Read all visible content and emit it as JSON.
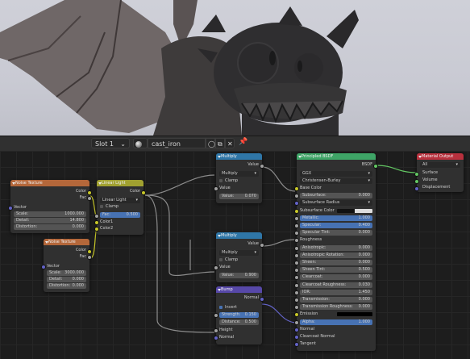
{
  "header": {
    "slot_label": "Slot 1",
    "material_name": "cast_iron"
  },
  "nodes": {
    "noise1": {
      "title": "Noise Texture",
      "color": "Color",
      "fac": "Fac",
      "vector": "Vector",
      "scale_label": "Scale:",
      "scale_value": "1000.000",
      "detail_label": "Detail:",
      "detail_value": "14.800",
      "distortion_label": "Distortion:",
      "distortion_value": "0.000"
    },
    "noise2": {
      "title": "Noise Texture",
      "color": "Color",
      "fac": "Fac",
      "vector": "Vector",
      "scale_label": "Scale:",
      "scale_value": "3000.000",
      "detail_label": "Detail:",
      "detail_value": "0.000",
      "distortion_label": "Distortion:",
      "distortion_value": "0.000"
    },
    "linear_light": {
      "title": "Linear Light",
      "color_out": "Color",
      "mode": "Linear Light",
      "clamp": "Clamp",
      "fac_label": "Fac:",
      "fac_value": "0.500",
      "color1": "Color1",
      "color2": "Color2"
    },
    "multiply1": {
      "title": "Multiply",
      "value_out": "Value",
      "op": "Multiply",
      "clamp": "Clamp",
      "value_in": "Value",
      "value_label": "Value:",
      "value_value": "0.070"
    },
    "multiply2": {
      "title": "Multiply",
      "value_out": "Value",
      "op": "Multiply",
      "clamp": "Clamp",
      "value_in": "Value",
      "value_label": "Value:",
      "value_value": "0.900"
    },
    "bump": {
      "title": "Bump",
      "normal_out": "Normal",
      "invert": "Invert",
      "strength_label": "Strength:",
      "strength_value": "0.150",
      "distance_label": "Distance:",
      "distance_value": "0.500",
      "height": "Height",
      "normal_in": "Normal"
    },
    "bsdf": {
      "title": "Principled BSDF",
      "bsdf_out": "BSDF",
      "distribution": "GGX",
      "subsurface_method": "Christensen-Burley",
      "rows": [
        {
          "label": "Base Color",
          "value": "",
          "kind": "plain"
        },
        {
          "label": "Subsurface:",
          "value": "0.000",
          "kind": "field"
        },
        {
          "label": "Subsurface Radius",
          "value": "",
          "kind": "drop"
        },
        {
          "label": "Subsurface Color",
          "value": "",
          "kind": "swatch"
        },
        {
          "label": "Metallic:",
          "value": "1.000",
          "kind": "blue"
        },
        {
          "label": "Specular:",
          "value": "0.400",
          "kind": "blue"
        },
        {
          "label": "Specular Tint:",
          "value": "0.000",
          "kind": "field"
        },
        {
          "label": "Roughness",
          "value": "",
          "kind": "plain"
        },
        {
          "label": "Anisotropic:",
          "value": "0.000",
          "kind": "field"
        },
        {
          "label": "Anisotropic Rotation:",
          "value": "0.000",
          "kind": "field"
        },
        {
          "label": "Sheen:",
          "value": "0.000",
          "kind": "field"
        },
        {
          "label": "Sheen Tint:",
          "value": "0.500",
          "kind": "field"
        },
        {
          "label": "Clearcoat:",
          "value": "0.000",
          "kind": "field"
        },
        {
          "label": "Clearcoat Roughness:",
          "value": "0.030",
          "kind": "field"
        },
        {
          "label": "IOR:",
          "value": "1.450",
          "kind": "field"
        },
        {
          "label": "Transmission:",
          "value": "0.000",
          "kind": "field"
        },
        {
          "label": "Transmission Roughness:",
          "value": "0.000",
          "kind": "field"
        },
        {
          "label": "Emission",
          "value": "",
          "kind": "swatch-black"
        },
        {
          "label": "Alpha:",
          "value": "1.000",
          "kind": "blue"
        },
        {
          "label": "Normal",
          "value": "",
          "kind": "plain"
        },
        {
          "label": "Clearcoat Normal",
          "value": "",
          "kind": "plain"
        },
        {
          "label": "Tangent",
          "value": "",
          "kind": "plain"
        }
      ]
    },
    "output": {
      "title": "Material Output",
      "target": "All",
      "surface": "Surface",
      "volume": "Volume",
      "displacement": "Displacement"
    }
  },
  "colors": {
    "texture_header": "#b4673a",
    "color_header": "#a1a130",
    "converter_header": "#2f76a7",
    "vector_header": "#5748a8",
    "shader_header": "#3ea466",
    "output_header": "#b8303d",
    "socket_color": "#c7c729",
    "socket_float": "#a1a1a1",
    "socket_vector": "#6363c7",
    "socket_shader": "#63c763"
  }
}
